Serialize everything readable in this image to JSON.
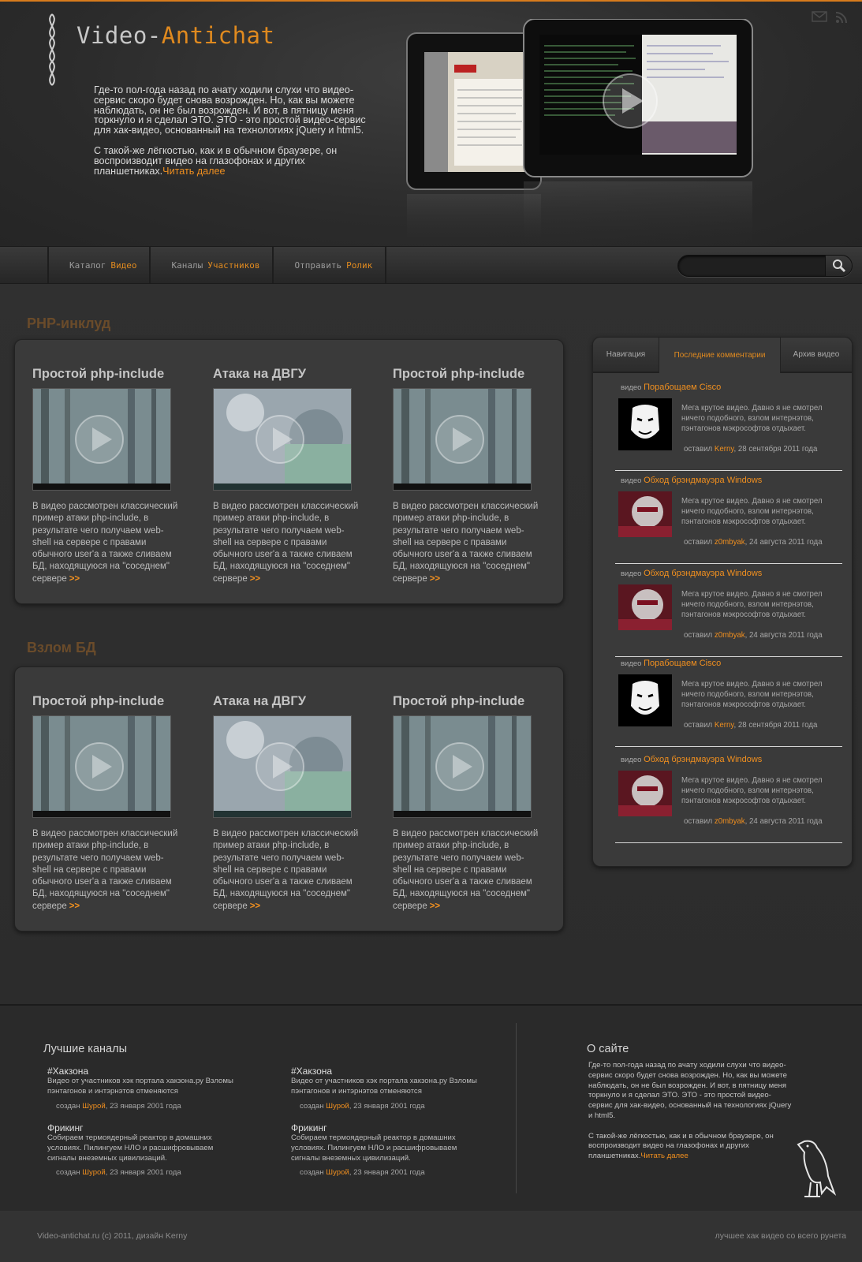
{
  "header": {
    "logo_prefix": "Video-",
    "logo_accent": "Antichat",
    "intro_p1": "Где-то пол-года назад по ачату ходили слухи что видео-сервис скоро будет снова возрожден. Но, как вы можете наблюдать, он не был возрожден. И вот, в пятницу меня торкнуло и я сделал ЭТО. ЭТО - это простой видео-сервис для хак-видео, основанный на технологиях jQuery и html5.",
    "intro_p2": "С такой-же лёгкостью, как и в обычном браузере, он воспроизводит видео на глазофонах и других планшетниках.",
    "read_more": "Читать далее",
    "icons": [
      "mail-icon",
      "rss-icon"
    ]
  },
  "nav": {
    "items": [
      {
        "label": "Каталог",
        "accent": "Видео"
      },
      {
        "label": "Каналы",
        "accent": "Участников"
      },
      {
        "label": "Отправить",
        "accent": "Ролик"
      }
    ],
    "search_placeholder": ""
  },
  "sections": [
    {
      "title": "PHP-инклуд",
      "videos": [
        {
          "title": "Простой php-include",
          "desc": "В видео рассмотрен классический пример атаки php-include, в результате чего получаем web-shell на сервере с правами обычного user'a а также сливаем БД, находящуюся на \"соседнем\" сервере",
          "more": ">>"
        },
        {
          "title": "Атака на ДВГУ",
          "desc": "В видео рассмотрен классический пример атаки php-include, в результате чего получаем web-shell на сервере с правами обычного user'a а также сливаем БД, находящуюся на \"соседнем\" сервере",
          "more": ">>"
        },
        {
          "title": "Простой php-include",
          "desc": "В видео рассмотрен классический пример атаки php-include, в результате чего получаем web-shell на сервере с правами обычного user'a а также сливаем БД, находящуюся на \"соседнем\" сервере",
          "more": ">>"
        }
      ]
    },
    {
      "title": "Взлом БД",
      "videos": [
        {
          "title": "Простой php-include",
          "desc": "В видео рассмотрен классический пример атаки php-include, в результате чего получаем web-shell на сервере с правами обычного user'a а также сливаем БД, находящуюся на \"соседнем\" сервере",
          "more": ">>"
        },
        {
          "title": "Атака на ДВГУ",
          "desc": "В видео рассмотрен классический пример атаки php-include, в результате чего получаем web-shell на сервере с правами обычного user'a а также сливаем БД, находящуюся на \"соседнем\" сервере",
          "more": ">>"
        },
        {
          "title": "Простой php-include",
          "desc": "В видео рассмотрен классический пример атаки php-include, в результате чего получаем web-shell на сервере с правами обычного user'a а также сливаем БД, находящуюся на \"соседнем\" сервере",
          "more": ">>"
        }
      ]
    }
  ],
  "sidebar": {
    "tabs": [
      "Навигация",
      "Последние комментарии",
      "Архив видео"
    ],
    "comment_prefix": "видео",
    "comments": [
      {
        "video": "Порабощаем Cisco",
        "text": "Мега крутое видео. Давно я не смотрел ничего подобного, взлом интернэтов, пэнтагонов мэкрософтов отдыхает.",
        "by_prefix": "оставил",
        "author": "Kerny",
        "date": ", 28 сентября 2011 года"
      },
      {
        "video": "Обход брэндмауэра Windows",
        "text": "Мега крутое видео. Давно я не смотрел ничего подобного, взлом интернэтов, пэнтагонов мэкрософтов отдыхает.",
        "by_prefix": "оставил",
        "author": "z0mbyak",
        "date": ", 24 августа 2011 года"
      },
      {
        "video": "Обход брэндмауэра Windows",
        "text": "Мега крутое видео. Давно я не смотрел ничего подобного, взлом интернэтов, пэнтагонов мэкрософтов отдыхает.",
        "by_prefix": "оставил",
        "author": "z0mbyak",
        "date": ", 24 августа 2011 года"
      },
      {
        "video": "Порабощаем Cisco",
        "text": "Мега крутое видео. Давно я не смотрел ничего подобного, взлом интернэтов, пэнтагонов мэкрософтов отдыхает.",
        "by_prefix": "оставил",
        "author": "Kerny",
        "date": ", 28 сентября 2011 года"
      },
      {
        "video": "Обход брэндмауэра Windows",
        "text": "Мега крутое видео. Давно я не смотрел ничего подобного, взлом интернэтов, пэнтагонов мэкрософтов отдыхает.",
        "by_prefix": "оставил",
        "author": "z0mbyak",
        "date": ", 24 августа 2011 года"
      }
    ]
  },
  "footer": {
    "channels_title": "Лучшие каналы",
    "channels": [
      {
        "name": "#Хакзона",
        "desc": "Видео от участников хэк портала хакзона.ру Взломы пэнтагонов и интэрнэтов отменяются",
        "by_prefix": "создан",
        "author": "Шурой",
        "date": ", 23 января 2001 года"
      },
      {
        "name": "#Хакзона",
        "desc": "Видео от участников хэк портала хакзона.ру Взломы пэнтагонов и интэрнэтов отменяются",
        "by_prefix": "создан",
        "author": "Шурой",
        "date": ", 23 января 2001 года"
      },
      {
        "name": "Фрикинг",
        "desc": "Собираем термоядерный реактор в домашних условиях. Пилингуем НЛО и расшифровываем сигналы внеземных цивилизаций.",
        "by_prefix": "создан",
        "author": "Шурой",
        "date": ", 23 января 2001 года"
      },
      {
        "name": "Фрикинг",
        "desc": "Собираем термоядерный реактор в домашних условиях. Пилингуем НЛО и расшифровываем сигналы внеземных цивилизаций.",
        "by_prefix": "создан",
        "author": "Шурой",
        "date": ", 23 января 2001 года"
      }
    ],
    "about_title": "О сайте",
    "about_p1": "Где-то пол-года назад по ачату ходили слухи что видео-сервис скоро будет снова возрожден. Но, как вы можете наблюдать, он не был возрожден. И вот, в пятницу меня торкнуло и я сделал ЭТО. ЭТО - это простой видео-сервис для хак-видео, основанный на технологиях jQuery и html5.",
    "about_p2": "С такой-же лёгкостью, как и в обычном браузере, он воспроизводит видео на глазофонах и других планшетниках.",
    "about_more": "Читать далее",
    "copyright": "Video-antichat.ru (c) 2011, дизайн Kerny",
    "slogan": "лучшее хак видео со всего рунета"
  },
  "colors": {
    "accent": "#e08a1f",
    "background": "#2e2e2e"
  }
}
